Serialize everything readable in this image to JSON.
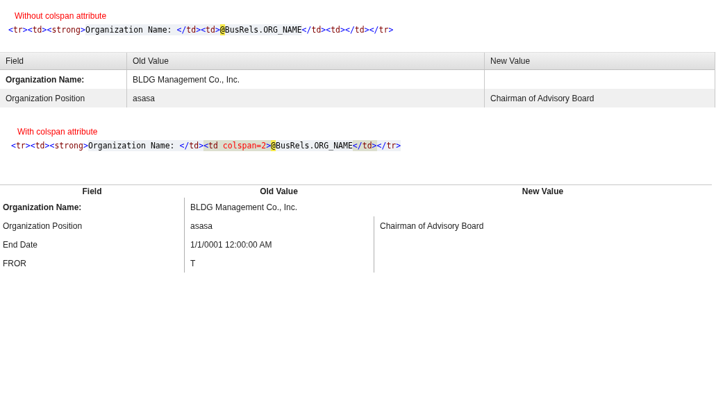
{
  "sections": [
    {
      "caption": "Without colspan attribute",
      "code": [
        {
          "text": "<tr><td><strong>",
          "kind": "tag",
          "current_line": false,
          "matched": false
        },
        {
          "text": "Organization Name: ",
          "kind": "text",
          "current_line": true,
          "matched": false
        },
        {
          "text": "</td><td>",
          "kind": "tag",
          "current_line": true,
          "matched": false
        },
        {
          "text": "@",
          "kind": "at"
        },
        {
          "text": "BusRels.ORG_NAME",
          "kind": "text",
          "current_line": true,
          "matched": false
        },
        {
          "text": "</td><td></td></tr>",
          "kind": "tag",
          "current_line": false,
          "matched": false
        }
      ],
      "table": {
        "columns": [
          "Field",
          "Old Value",
          "New Value"
        ],
        "rows": [
          {
            "emphasis": true,
            "cells": [
              "Organization Name:",
              "BLDG Management Co., Inc.",
              ""
            ]
          },
          {
            "emphasis": false,
            "cells": [
              "Organization Position",
              "asasa",
              "Chairman of Advisory Board"
            ]
          }
        ]
      }
    },
    {
      "caption": "With colspan attribute",
      "code": [
        {
          "text": "<tr><td><strong>",
          "kind": "tag",
          "current_line": false,
          "matched": false
        },
        {
          "text": "Organization Name: ",
          "kind": "text",
          "current_line": true,
          "matched": false
        },
        {
          "text": "</td>",
          "kind": "tag",
          "current_line": true,
          "matched": false
        },
        {
          "text": "<td ",
          "kind": "tag",
          "current_line": false,
          "matched": true
        },
        {
          "text": "colspan=2",
          "kind": "attr",
          "current_line": false,
          "matched": true
        },
        {
          "text": ">",
          "kind": "tag",
          "current_line": false,
          "matched": true
        },
        {
          "text": "@",
          "kind": "at"
        },
        {
          "text": "BusRels.ORG_NAME",
          "kind": "text",
          "current_line": true,
          "matched": false
        },
        {
          "text": "</td>",
          "kind": "tag",
          "current_line": false,
          "matched": true
        },
        {
          "text": "</tr>",
          "kind": "tag",
          "current_line": true,
          "matched": false
        }
      ],
      "table": {
        "columns": [
          "Field",
          "Old Value",
          "New Value"
        ],
        "rows": [
          {
            "emphasis": true,
            "kind": "spanning",
            "cells": [
              "Organization Name:",
              "BLDG Management Co., Inc."
            ]
          },
          {
            "emphasis": false,
            "kind": "normal",
            "cells": [
              "Organization Position",
              "asasa",
              "Chairman of Advisory Board"
            ]
          },
          {
            "emphasis": false,
            "kind": "normal",
            "cells": [
              "End Date",
              "1/1/0001 12:00:00 AM",
              ""
            ]
          },
          {
            "emphasis": false,
            "kind": "normal",
            "cells": [
              "FROR",
              "T",
              ""
            ]
          }
        ]
      }
    }
  ]
}
